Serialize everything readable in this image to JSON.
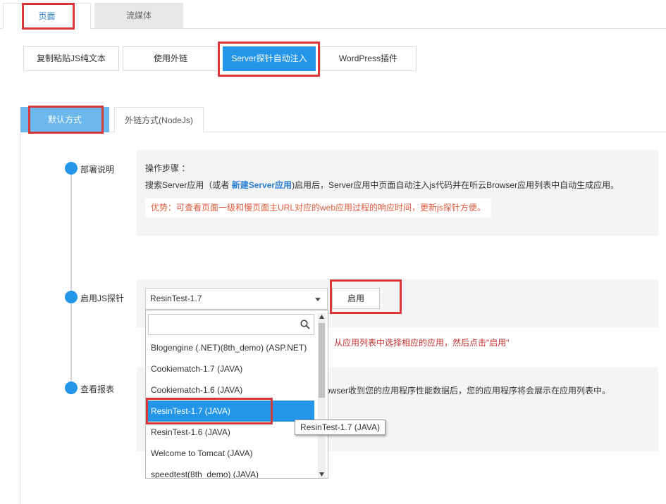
{
  "top_tabs": [
    {
      "label": "页面",
      "active": true
    },
    {
      "label": "流媒体",
      "active": false
    }
  ],
  "method_buttons": [
    {
      "label": "复制粘贴JS纯文本",
      "active": false
    },
    {
      "label": "使用外链",
      "active": false
    },
    {
      "label": "Server探针自动注入",
      "active": true
    },
    {
      "label": "WordPress插件",
      "active": false
    }
  ],
  "sub_tabs": [
    {
      "label": "默认方式",
      "active": true
    },
    {
      "label": "外链方式(NodeJs)",
      "active": false
    }
  ],
  "steps": {
    "deploy": {
      "label": "部署说明",
      "heading": "操作步骤 ：",
      "desc_prefix": "搜索Server应用（或者 ",
      "desc_link": "新建Server应用",
      "desc_suffix": ")启用后，Server应用中页面自动注入js代码并在听云Browser应用列表中自动生成应用。",
      "note": "优势：可查看页面一级和慢页面主URL对应的web应用过程的响应时间，更新js探针方便。"
    },
    "enable": {
      "label": "启用JS探针",
      "selected_app": "ResinTest-1.7",
      "enable_button": "启用",
      "hint": "从应用列表中选择相应的应用，然后点击\"启用\""
    },
    "report": {
      "label": "查看报表",
      "text": "owser收到您的应用程序性能数据后，您的应用程序将会展示在应用列表中。"
    }
  },
  "dropdown": {
    "search_placeholder": "",
    "options": [
      "Blogengine (.NET)(8th_demo) (ASP.NET)",
      "Cookiematch-1.7 (JAVA)",
      "Cookiematch-1.6 (JAVA)",
      "ResinTest-1.7 (JAVA)",
      "ResinTest-1.6 (JAVA)",
      "Welcome to Tomcat (JAVA)",
      "speedtest(8th_demo) (JAVA)"
    ],
    "selected_index": 3
  },
  "tooltip": "ResinTest-1.7 (JAVA)",
  "colors": {
    "accent": "#2396ea",
    "highlight": "#d9373a",
    "note": "#e05a3c",
    "hint": "#c62f2f"
  }
}
